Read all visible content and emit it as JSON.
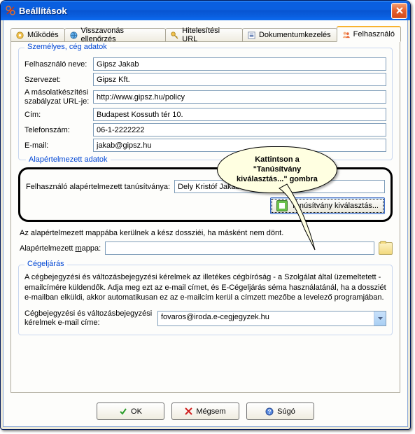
{
  "window": {
    "title": "Beállítások"
  },
  "tabs": {
    "items": [
      {
        "label": "Működés"
      },
      {
        "label": "Visszavonás ellenőrzés"
      },
      {
        "label": "Hitelesítési URL"
      },
      {
        "label": "Dokumentumkezelés"
      },
      {
        "label": "Felhasználó"
      }
    ],
    "active": 4
  },
  "personal": {
    "legend": "Személyes, cég adatok",
    "name_label": "Felhasználó neve:",
    "name_value": "Gipsz Jakab",
    "org_label": "Szervezet:",
    "org_value": "Gipsz Kft.",
    "policy_label_l1": "A másolatkészítési",
    "policy_label_l2": "szabályzat URL-je:",
    "policy_value": "http://www.gipsz.hu/policy",
    "address_label": "Cím:",
    "address_value": "Budapest Kossuth tér 10.",
    "phone_label": "Telefonszám:",
    "phone_value": "06-1-2222222",
    "email_label": "E-mail:",
    "email_value": "jakab@gipsz.hu"
  },
  "defaults": {
    "legend": "Alapértelmezett adatok",
    "cert_label": "Felhasználó alapértelmezett tanúsítványa:",
    "cert_value": "Dely Kristóf Jakab",
    "cert_button": "Tanúsítvány kiválasztás..."
  },
  "folder": {
    "note": "Az alapértelmezett mappába kerülnek a kész dossziéi, ha másként nem dönt.",
    "label_pre": "Alapértelmezett ",
    "label_u": "m",
    "label_post": "appa:",
    "value": ""
  },
  "ceg": {
    "legend": "Cégeljárás",
    "desc": "A cégbejegyzési és változásbejegyzési kérelmek az illetékes cégbíróság - a Szolgálat által üzemeltetett - emailcímére küldendők. Adja meg ezt az e-mail címet, és E-Cégeljárás séma használatánál, ha a dossziét e-mailban elküldi, akkor automatikusan ez az e-mailcím kerül a címzett mezőbe a levelező programjában.",
    "combo_label_l1": "Cégbejegyzési és változásbejegyzési",
    "combo_label_l2": "kérelmek e-mail címe:",
    "combo_value": "fovaros@iroda.e-cegjegyzek.hu"
  },
  "callout": {
    "l1": "Kattintson a",
    "l2": "\"Tanúsítvány",
    "l3": "kiválasztás...\" gombra"
  },
  "buttons": {
    "ok": "OK",
    "cancel": "Mégsem",
    "help": "Súgó"
  }
}
